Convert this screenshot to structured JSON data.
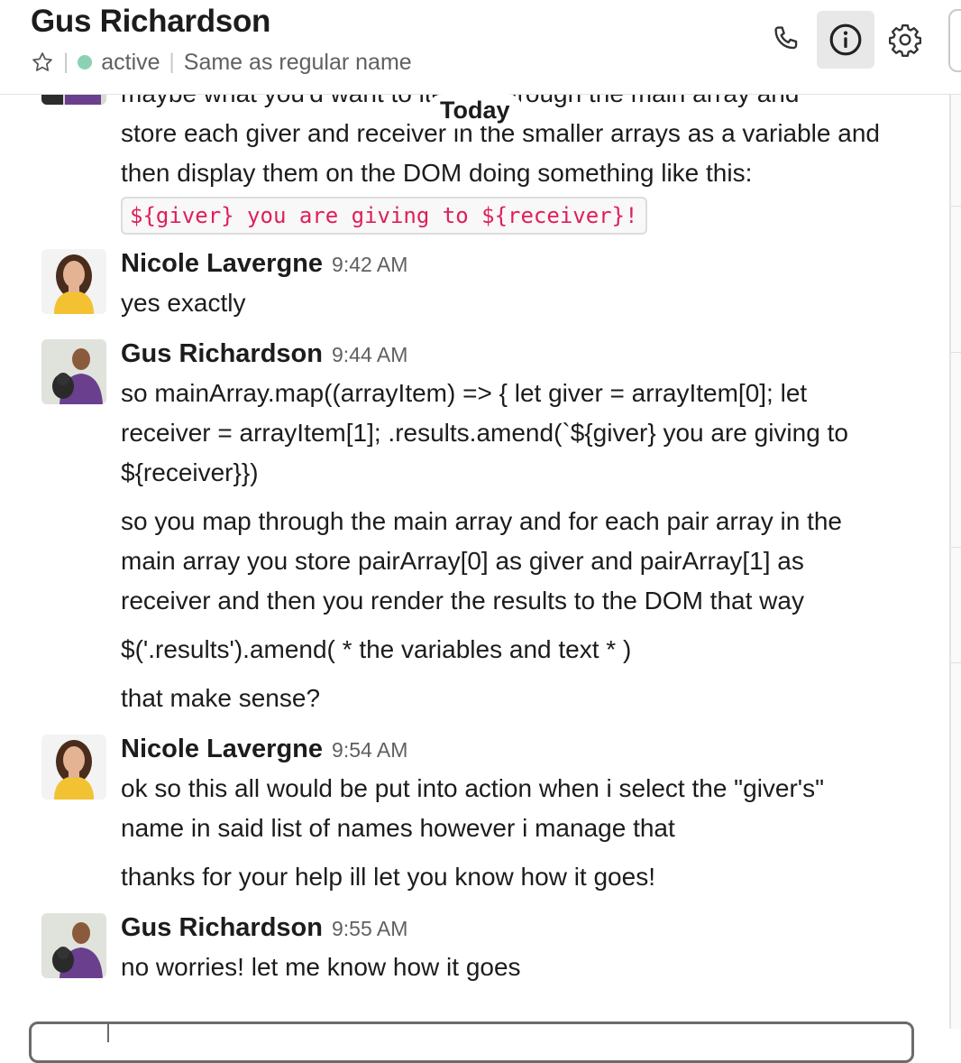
{
  "header": {
    "title": "Gus Richardson",
    "status": "active",
    "subtitle": "Same as regular name",
    "icons": {
      "star": "star-icon",
      "call": "phone-icon",
      "info": "info-icon",
      "settings": "gear-icon"
    },
    "presence_color": "#2bac76"
  },
  "divider": {
    "label": "Today"
  },
  "messages": [
    {
      "lines": [
        "maybe what you'd want to iterate through the main array and",
        "store each giver and receiver in the smaller arrays as a variable and",
        "then display them on the DOM doing something like this:"
      ],
      "code": "${giver} you are giving to ${receiver}!"
    },
    {
      "sender": "Nicole Lavergne",
      "time": "9:42 AM",
      "lines": [
        "yes exactly"
      ]
    },
    {
      "sender": "Gus Richardson",
      "time": "9:44 AM",
      "lines": [
        "so mainArray.map((arrayItem) => { let giver = arrayItem[0]; let",
        "receiver = arrayItem[1]; .results.amend(`${giver} you are giving to",
        "${receiver}})",
        "so you map through the main array and for each pair array in the",
        "main array you store pairArray[0] as giver and pairArray[1] as",
        "receiver and then you render the results to the DOM that way",
        "$('.results').amend(  * the variables and text * )",
        "that make sense?"
      ]
    },
    {
      "sender": "Nicole Lavergne",
      "time": "9:54 AM",
      "lines": [
        "ok so this all would be put into action when i select the \"giver's\"",
        "name in said list of names however i manage that",
        "thanks for your help ill let you know how it goes!"
      ]
    },
    {
      "sender": "Gus Richardson",
      "time": "9:55 AM",
      "lines": [
        "no worries! let me know how it goes"
      ]
    }
  ],
  "colors": {
    "code_text": "#e01e5a",
    "timestamp": "#616061",
    "text": "#1d1c1d"
  }
}
